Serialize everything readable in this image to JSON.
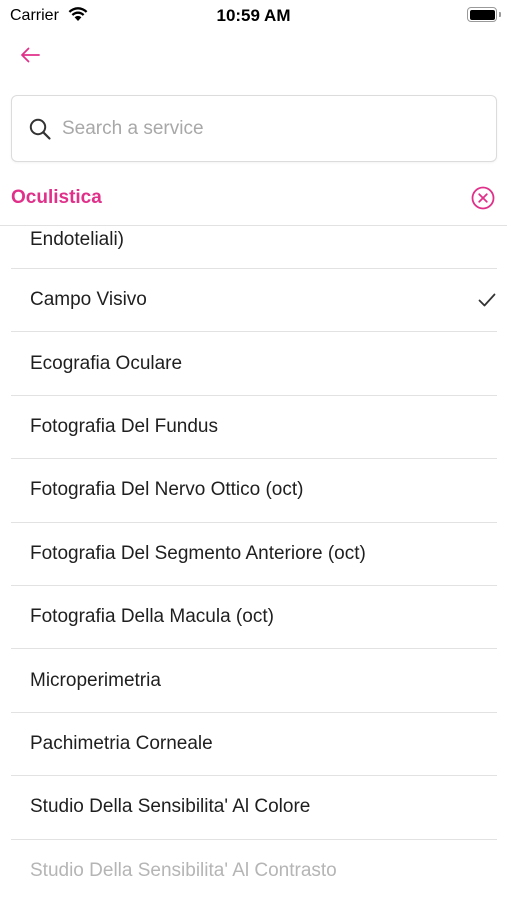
{
  "status_bar": {
    "carrier": "Carrier",
    "time": "10:59 AM"
  },
  "colors": {
    "accent": "#e0308a",
    "text": "#1f1f1f",
    "divider": "#e2e2e2",
    "placeholder": "#a8a8a8"
  },
  "nav": {
    "back_icon": "arrow-left-icon"
  },
  "search": {
    "placeholder": "Search a service",
    "value": "",
    "icon": "search-icon"
  },
  "category": {
    "title": "Oculistica",
    "clear_icon": "circle-x-icon"
  },
  "services": [
    {
      "label": "Endoteliali)",
      "selected": false
    },
    {
      "label": "Campo Visivo",
      "selected": true
    },
    {
      "label": "Ecografia Oculare",
      "selected": false
    },
    {
      "label": "Fotografia Del Fundus",
      "selected": false
    },
    {
      "label": "Fotografia Del Nervo Ottico (oct)",
      "selected": false
    },
    {
      "label": "Fotografia Del Segmento Anteriore (oct)",
      "selected": false
    },
    {
      "label": "Fotografia Della Macula (oct)",
      "selected": false
    },
    {
      "label": "Microperimetria",
      "selected": false
    },
    {
      "label": "Pachimetria Corneale",
      "selected": false
    },
    {
      "label": "Studio Della Sensibilita' Al Colore",
      "selected": false
    },
    {
      "label": "Studio Della Sensibilita' Al Contrasto",
      "selected": false
    }
  ]
}
